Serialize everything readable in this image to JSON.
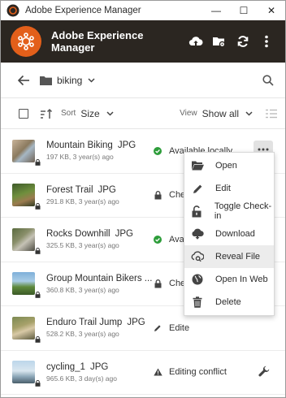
{
  "window": {
    "title": "Adobe Experience Manager",
    "controls": [
      "—",
      "☐",
      "✕"
    ]
  },
  "app": {
    "name": "Adobe Experience Manager",
    "accent": "#e35f1a",
    "header_bg": "#2b2621"
  },
  "nav": {
    "folder": "biking"
  },
  "toolbar": {
    "sort_label": "Sort",
    "sort_value": "Size",
    "view_label": "View",
    "view_value": "Show all"
  },
  "files": [
    {
      "name": "Mountain Biking",
      "type": "JPG",
      "details": "197 KB, 3 year(s) ago",
      "status": "Available locally",
      "status_icon": "check-circle-icon"
    },
    {
      "name": "Forest Trail",
      "type": "JPG",
      "details": "291.8 KB, 3 year(s) ago",
      "status": "Chec",
      "status_icon": "lock-icon"
    },
    {
      "name": "Rocks Downhill",
      "type": "JPG",
      "details": "325.5 KB, 3 year(s) ago",
      "status": "Avai",
      "status_icon": "check-circle-icon"
    },
    {
      "name": "Group Mountain Bikers ...",
      "type": "",
      "details": "360.8 KB, 3 year(s) ago",
      "status": "Chec",
      "status_icon": "lock-icon"
    },
    {
      "name": "Enduro Trail Jump",
      "type": "JPG",
      "details": "528.2 KB, 3 year(s) ago",
      "status": "Edite",
      "status_icon": "pencil-icon"
    },
    {
      "name": "cycling_1",
      "type": "JPG",
      "details": "965.6 KB, 3 day(s) ago",
      "status": "Editing conflict",
      "status_icon": "warning-icon"
    }
  ],
  "context_menu": {
    "items": [
      {
        "label": "Open",
        "icon": "folder-open-icon"
      },
      {
        "label": "Edit",
        "icon": "pencil-icon"
      },
      {
        "label": "Toggle Check-in",
        "icon": "unlock-icon"
      },
      {
        "label": "Download",
        "icon": "cloud-download-icon"
      },
      {
        "label": "Reveal File",
        "icon": "reveal-file-icon",
        "highlighted": true
      },
      {
        "label": "Open In Web",
        "icon": "globe-icon"
      },
      {
        "label": "Delete",
        "icon": "trash-icon"
      }
    ]
  },
  "colors": {
    "check_green": "#2d9d3a",
    "icon_dark": "#444444"
  }
}
